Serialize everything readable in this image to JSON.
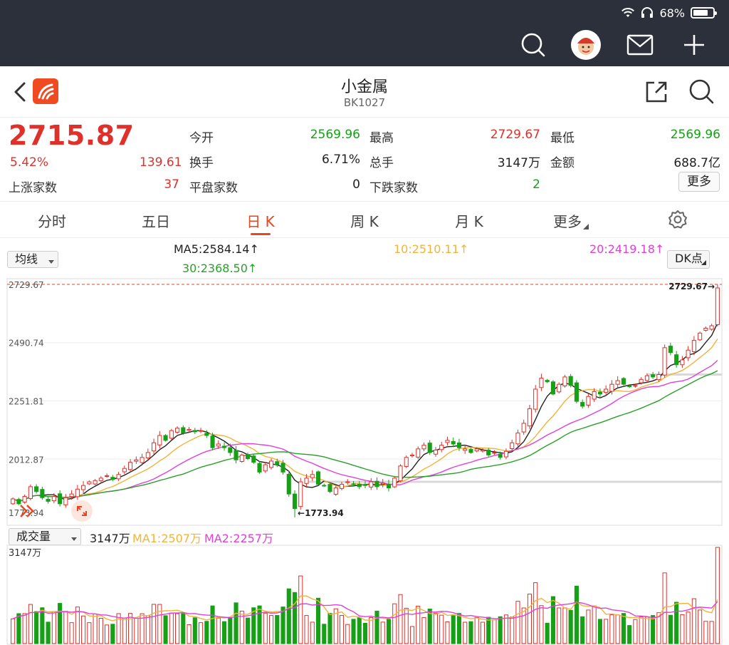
{
  "status_bar": {
    "battery": "68%"
  },
  "header": {
    "title": "小金属",
    "code": "BK1027"
  },
  "quote": {
    "price": "2715.87",
    "change_pct": "5.42%",
    "change": "139.61",
    "fields": [
      {
        "label": "今开",
        "value": "2569.96",
        "color": "green"
      },
      {
        "label": "最高",
        "value": "2729.67",
        "color": "red"
      },
      {
        "label": "最低",
        "value": "2569.96",
        "color": "green"
      },
      {
        "label": "换手",
        "value": "6.71%",
        "color": "dark"
      },
      {
        "label": "总手",
        "value": "3147万",
        "color": "dark"
      },
      {
        "label": "金额",
        "value": "688.7亿",
        "color": "dark"
      }
    ],
    "rise_label": "上涨家数",
    "rise_value": "37",
    "flat_label": "平盘家数",
    "flat_value": "0",
    "fall_label": "下跌家数",
    "fall_value": "2",
    "more_label": "更多"
  },
  "tabs": [
    "分时",
    "五日",
    "日 K",
    "周 K",
    "月 K",
    "更多"
  ],
  "active_tab": "日 K",
  "indicator": {
    "dropdown": "均线",
    "ma5": "MA5:2584.14",
    "ma10": "10:2510.11",
    "ma20": "20:2419.18",
    "ma30": "30:2368.50",
    "arrow": "↑",
    "dk": "DK点"
  },
  "colors": {
    "up": "#e0302a",
    "down": "#16a016",
    "ma5": "#222222",
    "ma10": "#f0b43a",
    "ma20": "#e040d8",
    "ma30": "#2aa02a",
    "accent": "#e8461f"
  },
  "chart_data": {
    "type": "candlestick",
    "y_labels": [
      "2729.67",
      "2490.74",
      "2251.81",
      "2012.87",
      "1773.94"
    ],
    "ylim": [
      1773.94,
      2729.67
    ],
    "high_label": "2729.67",
    "low_label": "1773.94",
    "close": [
      1850,
      1830,
      1860,
      1900,
      1880,
      1855,
      1840,
      1860,
      1830,
      1855,
      1870,
      1890,
      1905,
      1920,
      1925,
      1935,
      1945,
      1930,
      1950,
      1975,
      2000,
      2010,
      2020,
      2040,
      2080,
      2110,
      2090,
      2130,
      2140,
      2120,
      2135,
      2125,
      2130,
      2110,
      2060,
      2075,
      2060,
      2040,
      2010,
      2030,
      2015,
      2000,
      1960,
      1990,
      2005,
      1990,
      1960,
      1870,
      1810,
      1920,
      1935,
      1950,
      1910,
      1905,
      1880,
      1895,
      1910,
      1920,
      1910,
      1900,
      1905,
      1920,
      1900,
      1915,
      1895,
      1935,
      1985,
      2020,
      2030,
      2055,
      2070,
      2040,
      2050,
      2070,
      2090,
      2075,
      2060,
      2055,
      2040,
      2055,
      2050,
      2030,
      2040,
      2020,
      2045,
      2080,
      2120,
      2160,
      2220,
      2300,
      2345,
      2330,
      2280,
      2320,
      2350,
      2315,
      2250,
      2230,
      2270,
      2290,
      2280,
      2300,
      2320,
      2335,
      2320,
      2310,
      2315,
      2340,
      2355,
      2350,
      2360,
      2470,
      2450,
      2400,
      2420,
      2460,
      2500,
      2530,
      2550,
      2560,
      2715
    ],
    "volume_label": "成交量",
    "volume": "3147万",
    "vol_ma1": "MA1:2507万",
    "vol_ma2": "MA2:2257万",
    "vol_max_label": "3147万"
  }
}
